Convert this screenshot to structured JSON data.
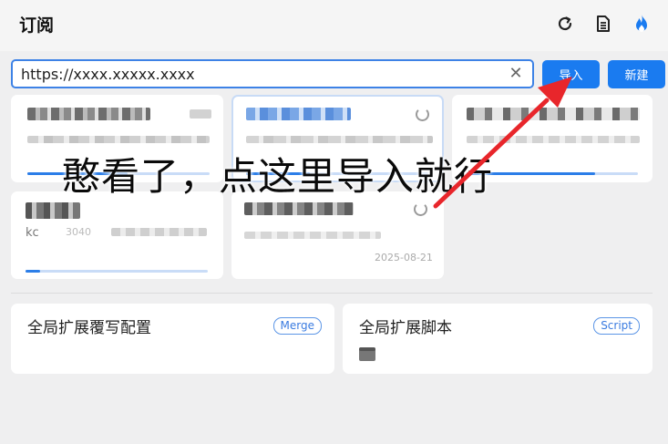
{
  "header": {
    "title": "订阅",
    "icons": [
      "refresh-icon",
      "document-icon",
      "flame-icon"
    ]
  },
  "url_bar": {
    "value": "https://xxxx.xxxxx.xxxx",
    "clear_label": "✕"
  },
  "buttons": {
    "import_label": "导入",
    "new_label": "新建"
  },
  "subscriptions": {
    "visible_texts": {
      "card4_fragment": "kc",
      "card4_count": "3040",
      "card5_date": "2025-08-21"
    },
    "progress": [
      0.55,
      0.35,
      0.75,
      0.08
    ]
  },
  "annotation": {
    "text": "憨看了，点这里导入就行"
  },
  "extensions": {
    "override_title": "全局扩展覆写配置",
    "override_badge": "Merge",
    "script_title": "全局扩展脚本",
    "script_badge": "Script"
  },
  "colors": {
    "accent": "#1a7bf0",
    "arrow": "#e8262b",
    "background": "#efeff0"
  }
}
